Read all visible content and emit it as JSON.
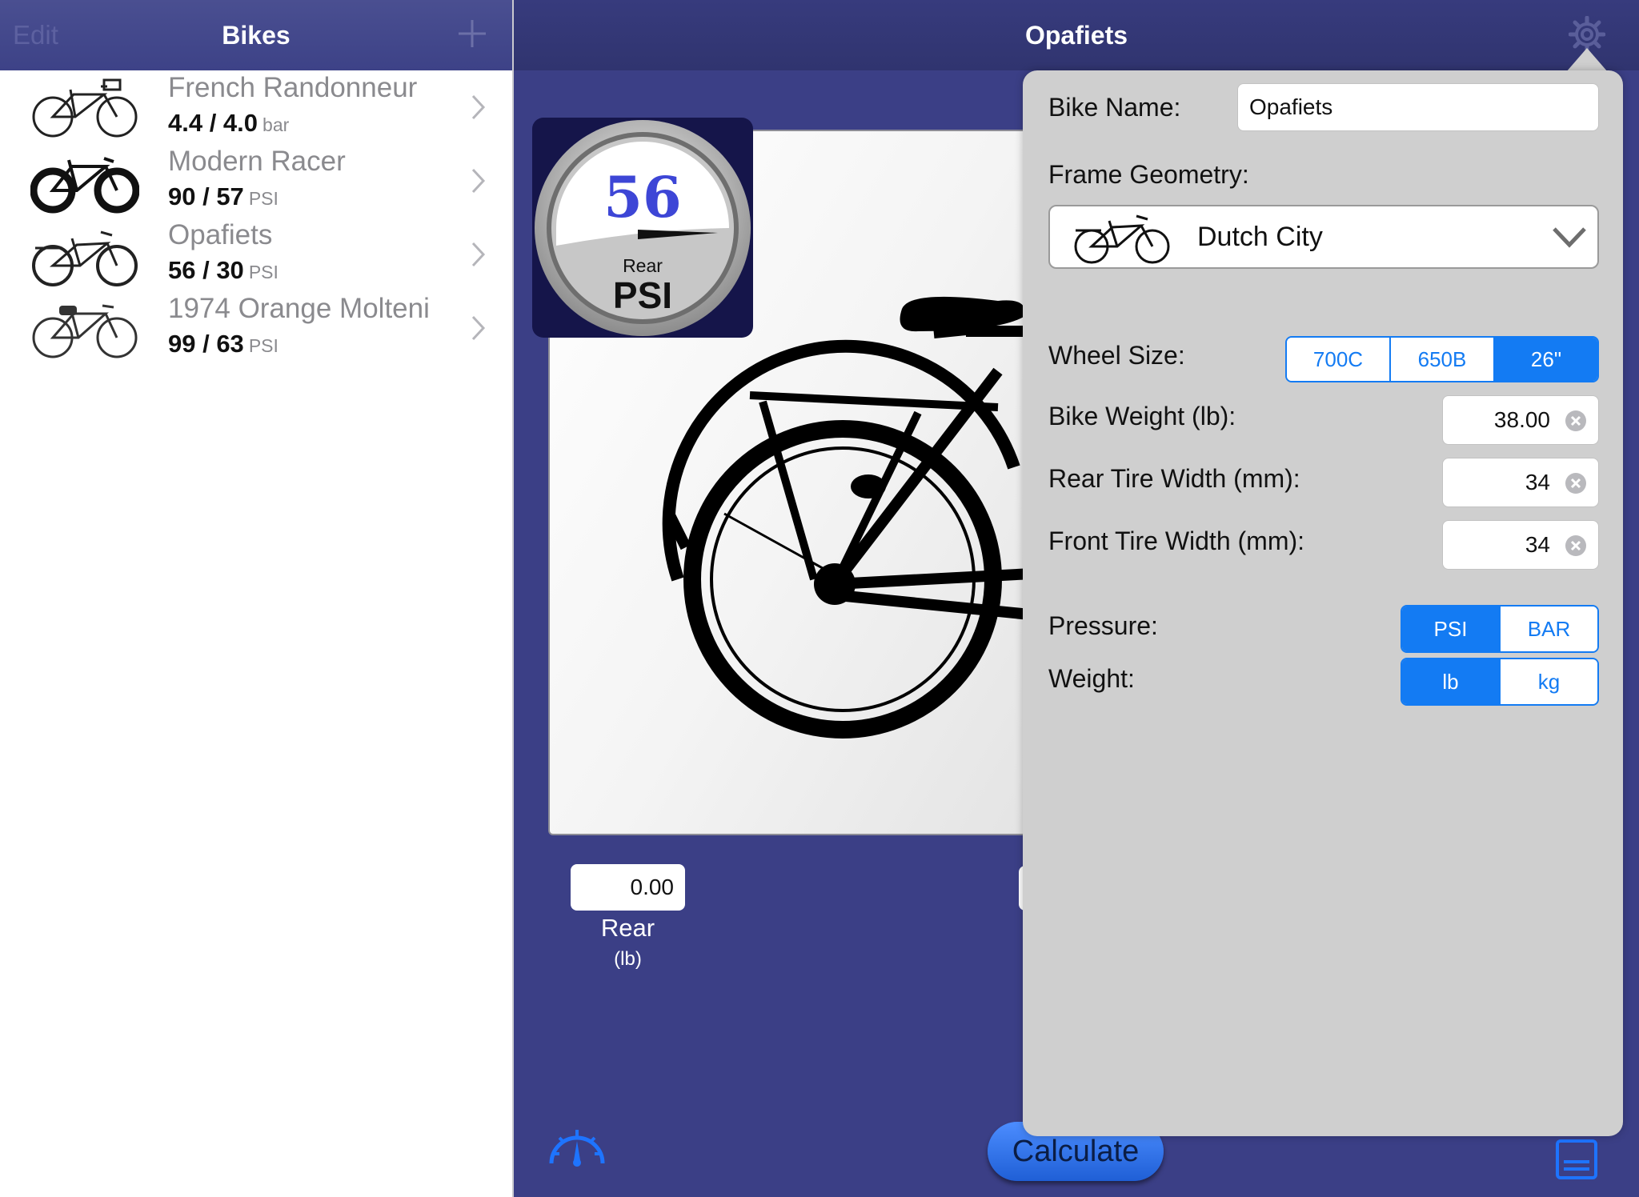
{
  "master": {
    "edit_label": "Edit",
    "title": "Bikes",
    "add_icon": "plus-icon",
    "bikes": [
      {
        "name": "French Randonneur",
        "pressure": "4.4 / 4.0",
        "unit": "bar"
      },
      {
        "name": "Modern Racer",
        "pressure": "90 / 57",
        "unit": "PSI"
      },
      {
        "name": "Opafiets",
        "pressure": "56 / 30",
        "unit": "PSI"
      },
      {
        "name": "1974 Orange Molteni",
        "pressure": "99 / 63",
        "unit": "PSI"
      }
    ]
  },
  "detail": {
    "title": "Opafiets",
    "settings_icon": "gear-icon",
    "gauge": {
      "value": "56",
      "position": "Rear",
      "unit": "PSI"
    },
    "rear_weight": {
      "value": "0.00",
      "label": "Rear",
      "unit": "(lb)"
    },
    "calculate_label": "Calculate",
    "speedometer_icon": "speedometer-icon",
    "notes_icon": "notes-icon"
  },
  "settings": {
    "bike_name_label": "Bike Name:",
    "bike_name_value": "Opafiets",
    "frame_geometry_label": "Frame Geometry:",
    "frame_geometry_value": "Dutch City",
    "wheel_size_label": "Wheel Size:",
    "wheel_sizes": [
      "700C",
      "650B",
      "26\""
    ],
    "wheel_size_selected": "26\"",
    "bike_weight_label": "Bike Weight (lb):",
    "bike_weight_value": "38.00",
    "rear_tire_label": "Rear Tire Width (mm):",
    "rear_tire_value": "34",
    "front_tire_label": "Front Tire Width (mm):",
    "front_tire_value": "34",
    "pressure_label": "Pressure:",
    "pressure_options": [
      "PSI",
      "BAR"
    ],
    "pressure_selected": "PSI",
    "weight_label": "Weight:",
    "weight_options": [
      "lb",
      "kg"
    ],
    "weight_selected": "lb"
  },
  "colors": {
    "nav_bar": "#3d4287",
    "detail_background": "#3b3f86",
    "accent": "#137bf3",
    "popover": "#cfcfcf",
    "gauge_value": "#3d46d6"
  }
}
